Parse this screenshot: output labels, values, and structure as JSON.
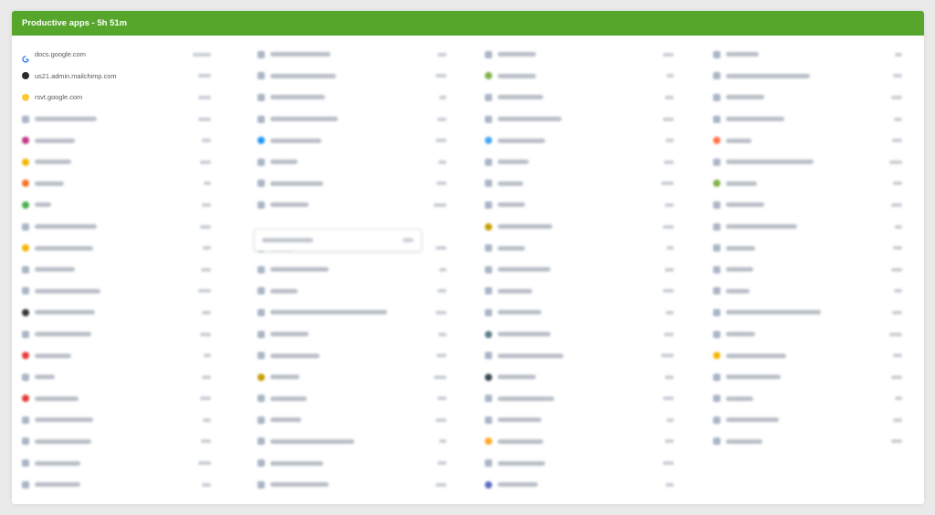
{
  "header": {
    "title": "Productive apps - 5h 51m"
  },
  "clear_rows": [
    {
      "label": "docs.google.com",
      "icon": "google-g-icon",
      "color": "#4285f4"
    },
    {
      "label": "us21.admin.mailchimp.com",
      "icon": "mailchimp-icon",
      "color": "#2b2b2b"
    },
    {
      "label": "rsvt.google.com",
      "icon": "google-shield-icon",
      "color": "#fbbc05"
    }
  ],
  "blurred_rows": {
    "col1": [
      {
        "color": "#a9b4c6",
        "w": 68
      },
      {
        "color": "#c13584",
        "w": 44
      },
      {
        "color": "#f4b400",
        "w": 40
      },
      {
        "color": "#f37021",
        "w": 32
      },
      {
        "color": "#4caf50",
        "w": 18
      },
      {
        "color": "#a9b4c6",
        "w": 68
      },
      {
        "color": "#f4b400",
        "w": 64
      },
      {
        "color": "#a9b4c6",
        "w": 44
      },
      {
        "color": "#a9b4c6",
        "w": 72
      },
      {
        "color": "#333333",
        "w": 66
      },
      {
        "color": "#a9b4c6",
        "w": 62
      },
      {
        "color": "#e53935",
        "w": 40
      },
      {
        "color": "#a9b4c6",
        "w": 22
      },
      {
        "color": "#e53935",
        "w": 48
      },
      {
        "color": "#a9b4c6",
        "w": 64
      },
      {
        "color": "#a9b4c6",
        "w": 62
      },
      {
        "color": "#a9b4c6",
        "w": 50
      },
      {
        "color": "#a9b4c6",
        "w": 50
      }
    ],
    "col2": [
      {
        "color": "#a9b4c6",
        "w": 66
      },
      {
        "color": "#a9b4c6",
        "w": 72
      },
      {
        "color": "#a9b4c6",
        "w": 60
      },
      {
        "color": "#a9b4c6",
        "w": 74
      },
      {
        "color": "#2196f3",
        "w": 56
      },
      {
        "color": "#a9b4c6",
        "w": 30
      },
      {
        "color": "#a9b4c6",
        "w": 58
      },
      {
        "color": "#a9b4c6",
        "w": 42
      },
      {
        "color": "#ffffff",
        "w": 0
      },
      {
        "color": "#4caf50",
        "w": 26
      },
      {
        "color": "#a9b4c6",
        "w": 64
      },
      {
        "color": "#a9b4c6",
        "w": 30
      },
      {
        "color": "#a9b4c6",
        "w": 128
      },
      {
        "color": "#a9b4c6",
        "w": 42
      },
      {
        "color": "#a9b4c6",
        "w": 54
      },
      {
        "color": "#c59a00",
        "w": 32
      },
      {
        "color": "#a9b4c6",
        "w": 40
      },
      {
        "color": "#a9b4c6",
        "w": 34
      },
      {
        "color": "#a9b4c6",
        "w": 92
      },
      {
        "color": "#a9b4c6",
        "w": 58
      },
      {
        "color": "#a9b4c6",
        "w": 64
      }
    ],
    "col3": [
      {
        "color": "#a9b4c6",
        "w": 42
      },
      {
        "color": "#7cb342",
        "w": 42
      },
      {
        "color": "#a9b4c6",
        "w": 50
      },
      {
        "color": "#a9b4c6",
        "w": 70
      },
      {
        "color": "#42a5f5",
        "w": 52
      },
      {
        "color": "#a9b4c6",
        "w": 34
      },
      {
        "color": "#a9b4c6",
        "w": 28
      },
      {
        "color": "#a9b4c6",
        "w": 30
      },
      {
        "color": "#c8a000",
        "w": 60
      },
      {
        "color": "#a9b4c6",
        "w": 30
      },
      {
        "color": "#a9b4c6",
        "w": 58
      },
      {
        "color": "#a9b4c6",
        "w": 38
      },
      {
        "color": "#a9b4c6",
        "w": 48
      },
      {
        "color": "#607d8b",
        "w": 58
      },
      {
        "color": "#a9b4c6",
        "w": 72
      },
      {
        "color": "#37474f",
        "w": 42
      },
      {
        "color": "#a9b4c6",
        "w": 62
      },
      {
        "color": "#a9b4c6",
        "w": 48
      },
      {
        "color": "#ffa726",
        "w": 50
      },
      {
        "color": "#a9b4c6",
        "w": 52
      },
      {
        "color": "#5c6bc0",
        "w": 44
      }
    ],
    "col4": [
      {
        "color": "#a9b4c6",
        "w": 36
      },
      {
        "color": "#a9b4c6",
        "w": 92
      },
      {
        "color": "#a9b4c6",
        "w": 42
      },
      {
        "color": "#a9b4c6",
        "w": 64
      },
      {
        "color": "#ff7043",
        "w": 28
      },
      {
        "color": "#a9b4c6",
        "w": 96
      },
      {
        "color": "#7cb342",
        "w": 34
      },
      {
        "color": "#a9b4c6",
        "w": 42
      },
      {
        "color": "#a9b4c6",
        "w": 78
      },
      {
        "color": "#a9b4c6",
        "w": 32
      },
      {
        "color": "#a9b4c6",
        "w": 30
      },
      {
        "color": "#a9b4c6",
        "w": 26
      },
      {
        "color": "#a9b4c6",
        "w": 104
      },
      {
        "color": "#a9b4c6",
        "w": 32
      },
      {
        "color": "#f4b400",
        "w": 66
      },
      {
        "color": "#a9b4c6",
        "w": 60
      },
      {
        "color": "#a9b4c6",
        "w": 30
      },
      {
        "color": "#a9b4c6",
        "w": 58
      },
      {
        "color": "#a9b4c6",
        "w": 40
      }
    ]
  }
}
